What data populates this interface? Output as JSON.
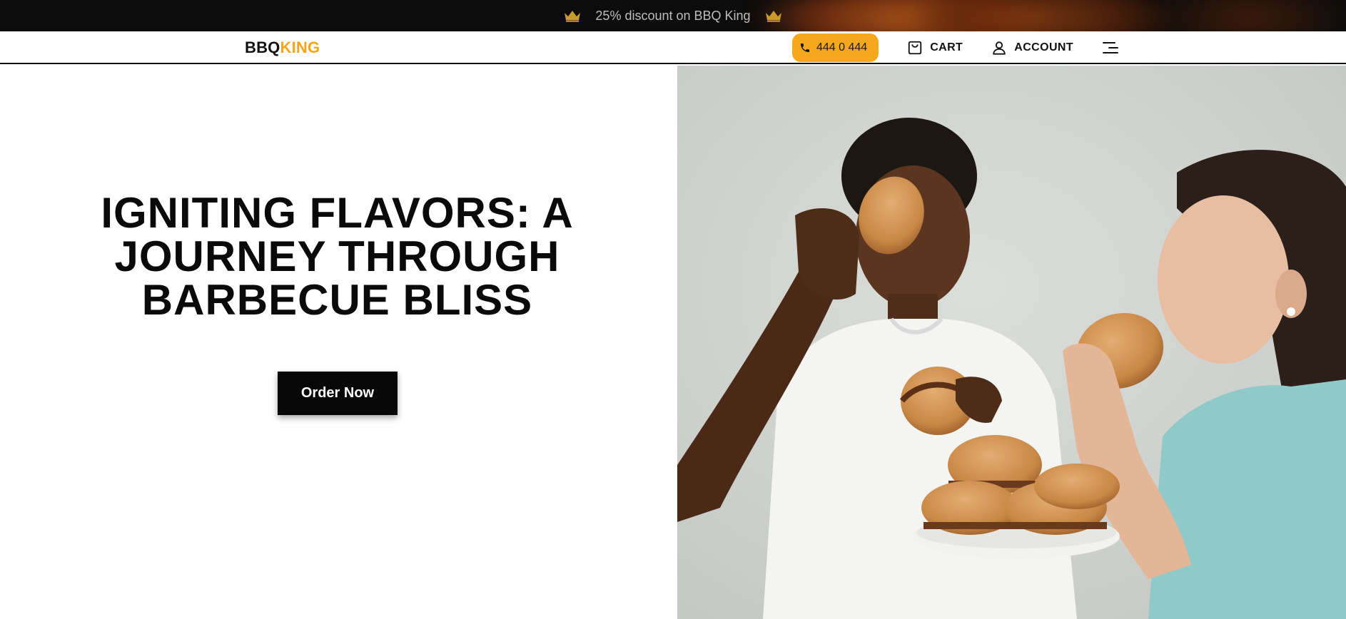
{
  "promo": {
    "text": "25% discount on BBQ King",
    "icons": [
      "crown-icon",
      "crown-icon"
    ],
    "crown_color": "#c99a2e"
  },
  "header": {
    "logo_part1": "BBQ",
    "logo_part2": "KING",
    "phone": "444 0 444",
    "cart_label": "CART",
    "account_label": "ACCOUNT",
    "icons": [
      "phone-icon",
      "cart-icon",
      "user-icon",
      "menu-icon"
    ]
  },
  "hero": {
    "title": "IGNITING FLAVORS: A JOURNEY THROUGH BARBECUE BLISS",
    "cta_label": "Order Now",
    "image_subject": "two women smiling and eating burgers with a plate of burgers"
  },
  "colors": {
    "accent": "#f6a81c",
    "logo_accent": "#f4a51c",
    "dark": "#0c0c0c",
    "cta_bg": "#070707"
  }
}
